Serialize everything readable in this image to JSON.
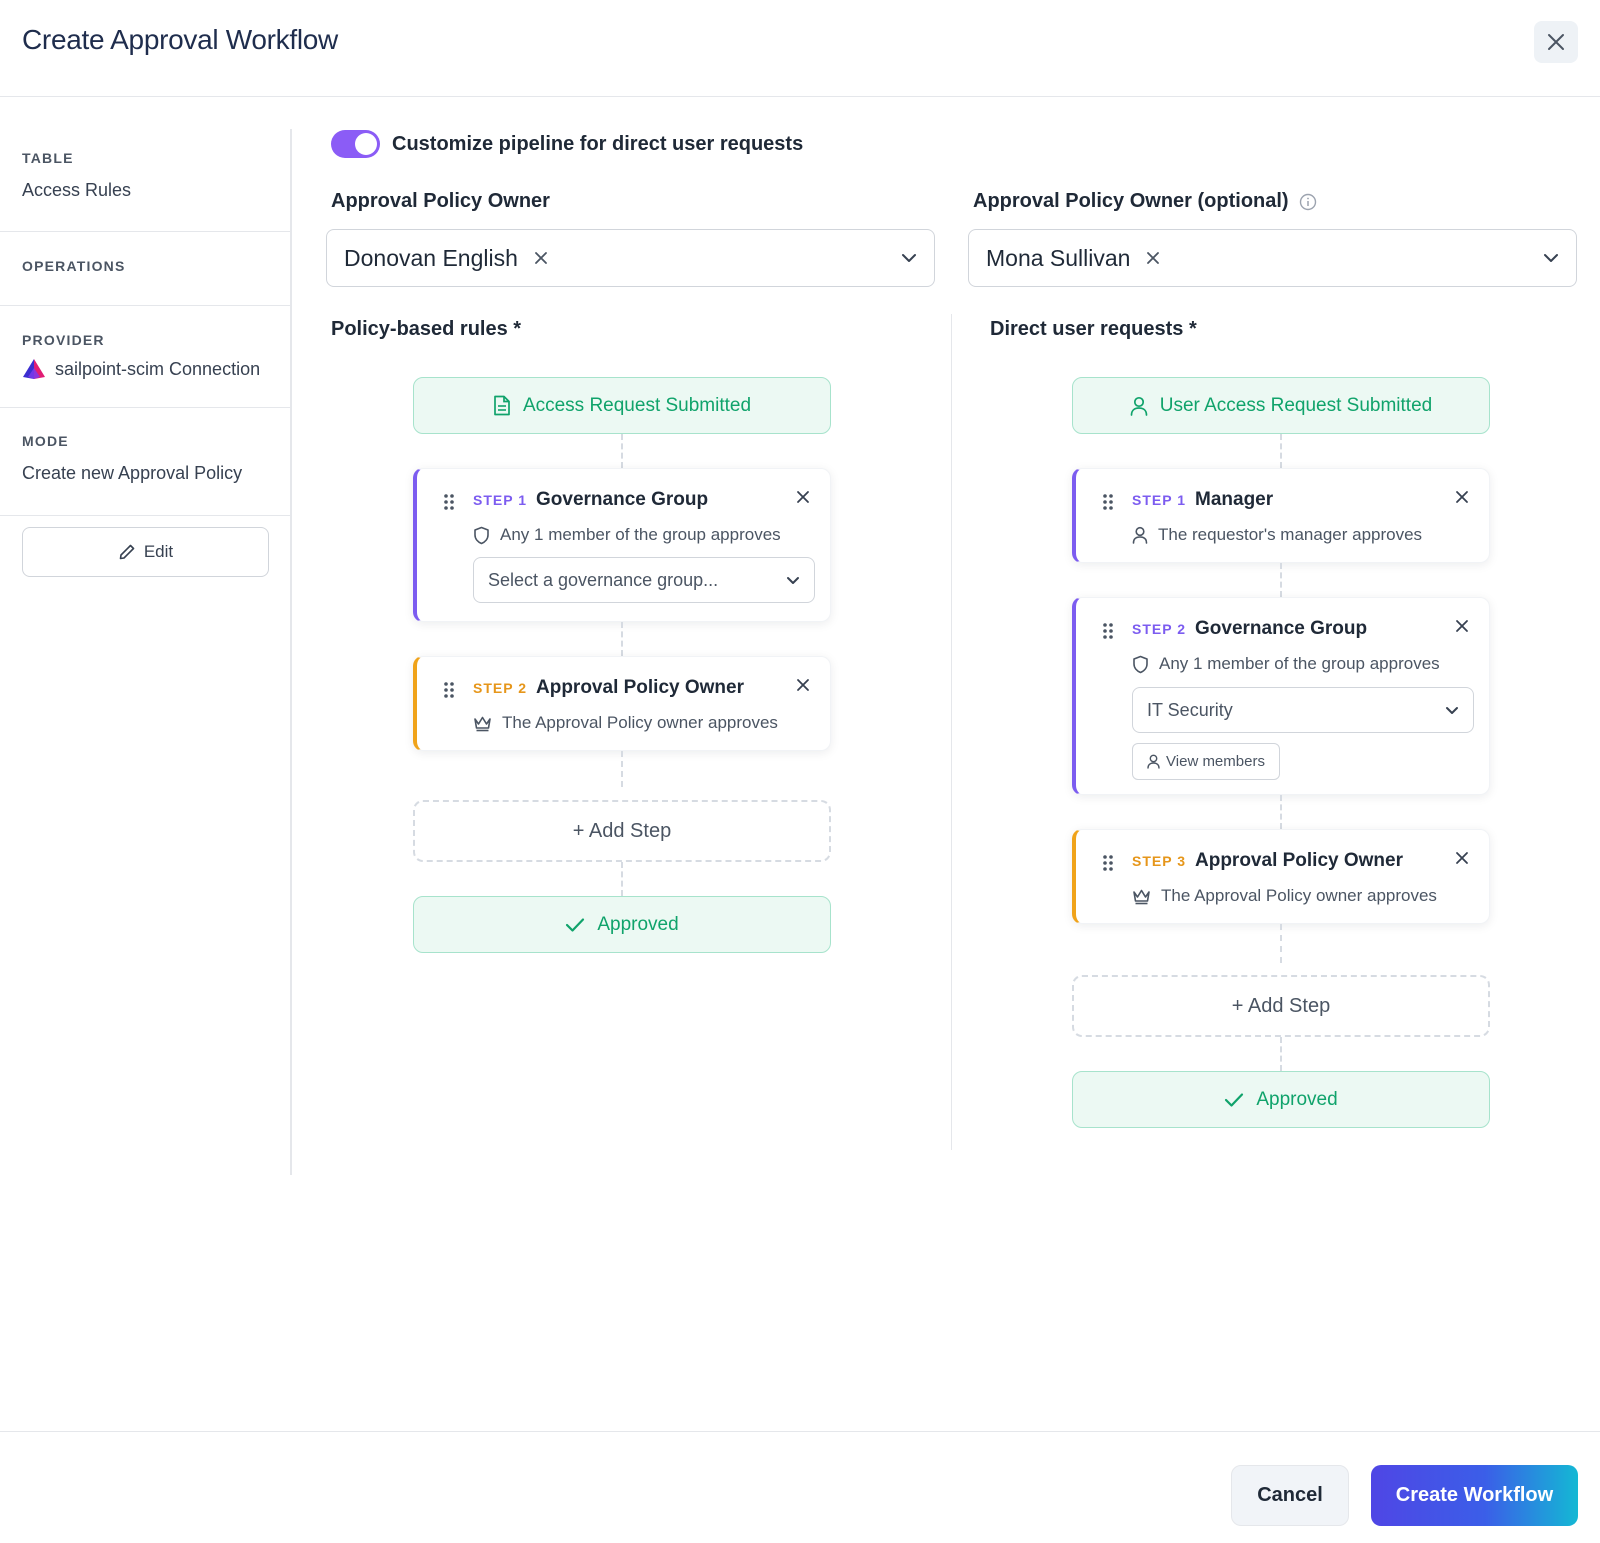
{
  "dialog": {
    "title": "Create Approval Workflow"
  },
  "sidebar": {
    "table_label": "TABLE",
    "table_value": "Access Rules",
    "operations_label": "OPERATIONS",
    "provider_label": "PROVIDER",
    "provider_value": "sailpoint-scim Connection",
    "mode_label": "MODE",
    "mode_value": "Create new Approval Policy",
    "edit_label": "Edit"
  },
  "toggle": {
    "label": "Customize pipeline for direct user requests",
    "on": true
  },
  "owner": {
    "label": "Approval Policy Owner",
    "value": "Donovan English"
  },
  "owner_optional": {
    "label": "Approval Policy Owner (optional)",
    "value": "Mona Sullivan"
  },
  "policy_rules": {
    "title": "Policy-based rules *",
    "start": "Access Request Submitted",
    "steps": [
      {
        "tag": "STEP 1",
        "name": "Governance Group",
        "desc": "Any 1 member of the group approves",
        "select_placeholder": "Select a governance group..."
      },
      {
        "tag": "STEP 2",
        "name": "Approval Policy Owner",
        "desc": "The Approval Policy owner approves"
      }
    ],
    "add_step": "+ Add Step",
    "end": "Approved"
  },
  "direct_requests": {
    "title": "Direct user requests *",
    "start": "User Access Request Submitted",
    "steps": [
      {
        "tag": "STEP 1",
        "name": "Manager",
        "desc": "The requestor's manager approves"
      },
      {
        "tag": "STEP 2",
        "name": "Governance Group",
        "desc": "Any 1 member of the group approves",
        "select_value": "IT Security",
        "view_members": "View members"
      },
      {
        "tag": "STEP 3",
        "name": "Approval Policy Owner",
        "desc": "The Approval Policy owner approves"
      }
    ],
    "add_step": "+ Add Step",
    "end": "Approved"
  },
  "footer": {
    "cancel": "Cancel",
    "create": "Create Workflow"
  },
  "colors": {
    "accent_purple": "#7c5cf0",
    "accent_amber": "#f0a31a",
    "success_green": "#10a36b",
    "primary_indigo": "#4f46e5"
  }
}
